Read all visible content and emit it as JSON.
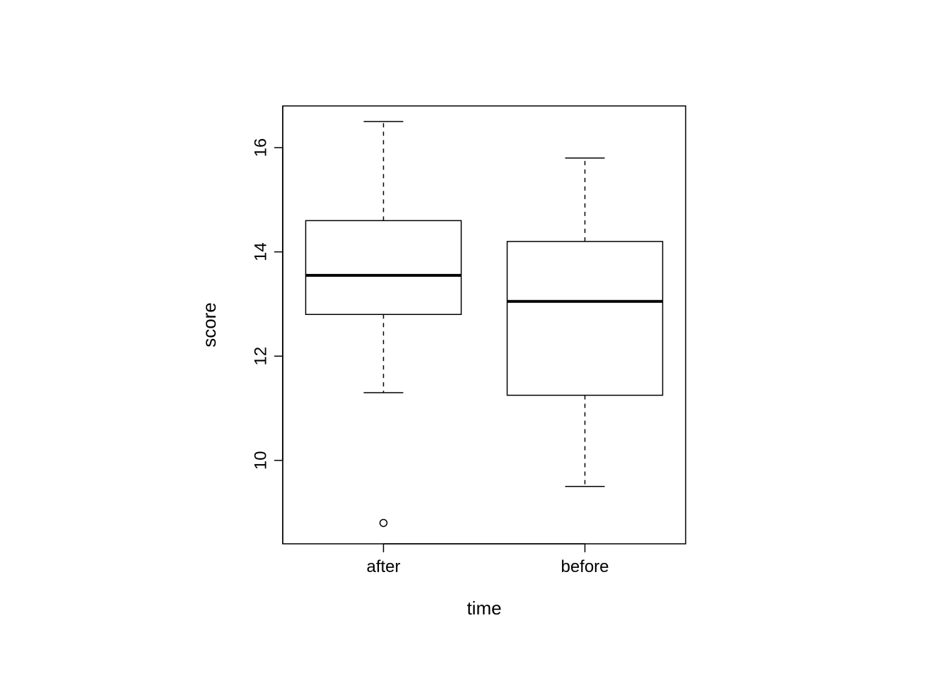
{
  "chart_data": {
    "type": "boxplot",
    "xlabel": "time",
    "ylabel": "score",
    "categories": [
      "after",
      "before"
    ],
    "y_ticks": [
      10,
      12,
      14,
      16
    ],
    "ylim": [
      8.4,
      16.8
    ],
    "series": [
      {
        "name": "after",
        "min_whisker": 11.3,
        "q1": 12.8,
        "median": 13.55,
        "q3": 14.6,
        "max_whisker": 16.5,
        "outliers": [
          8.8
        ]
      },
      {
        "name": "before",
        "min_whisker": 9.5,
        "q1": 11.25,
        "median": 13.05,
        "q3": 14.2,
        "max_whisker": 15.8,
        "outliers": []
      }
    ]
  },
  "colors": {
    "axis": "#000000",
    "box_stroke": "#000000",
    "box_fill": "#ffffff",
    "whisker": "#000000",
    "outlier": "#000000"
  }
}
